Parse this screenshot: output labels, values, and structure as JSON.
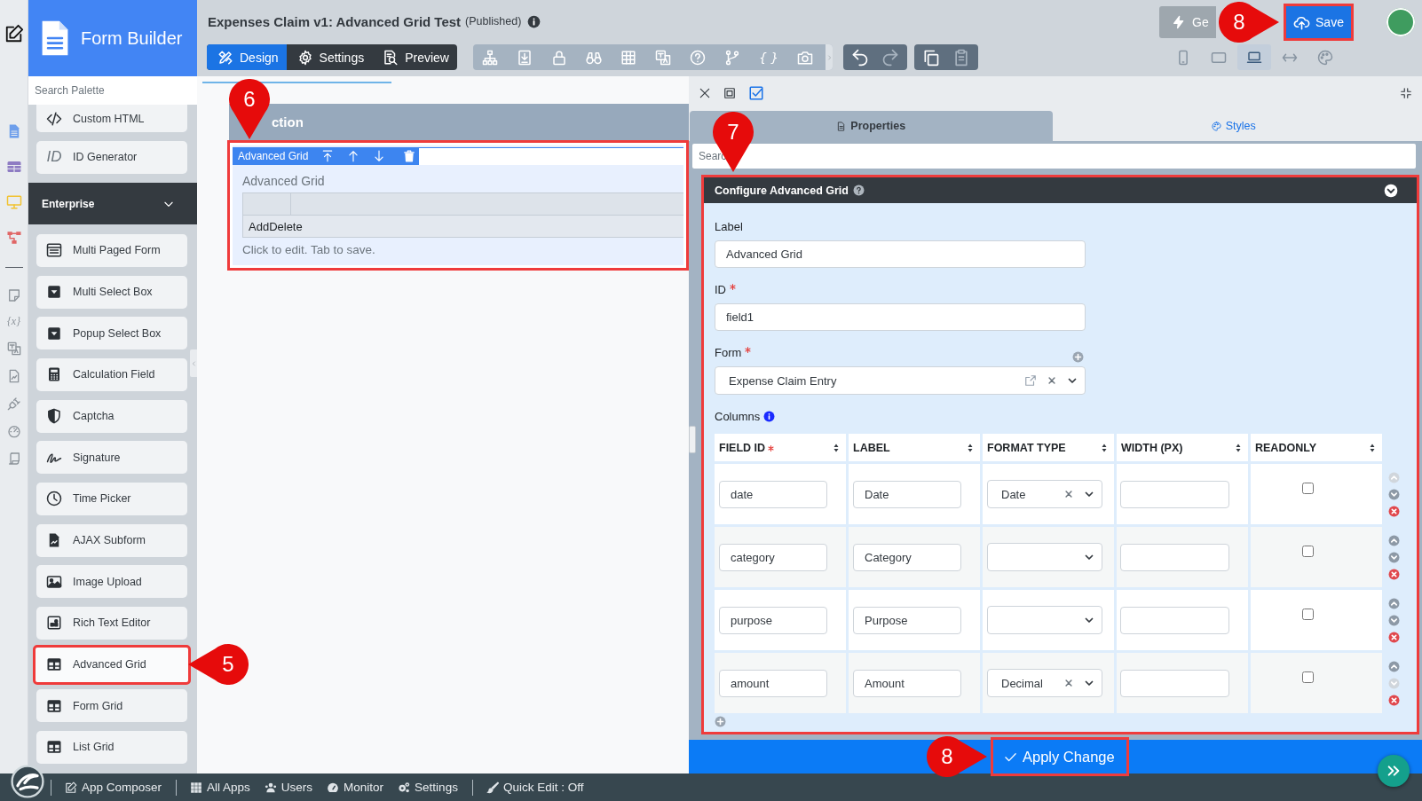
{
  "side_rail": {
    "glyph": "{x}"
  },
  "palette": {
    "title": "Form Builder",
    "search": {
      "placeholder": "Search Palette"
    },
    "items": [
      {
        "label": "Custom HTML",
        "highlighted": false
      },
      {
        "label": "ID Generator",
        "icon_text": "ID",
        "highlighted": false
      }
    ],
    "sections": [
      {
        "title": "Enterprise",
        "expanded": true,
        "items": [
          {
            "label": "Multi Paged Form",
            "highlighted": false
          },
          {
            "label": "Multi Select Box",
            "highlighted": false
          },
          {
            "label": "Popup Select Box",
            "highlighted": false
          },
          {
            "label": "Calculation Field",
            "highlighted": false
          },
          {
            "label": "Captcha",
            "highlighted": false
          },
          {
            "label": "Signature",
            "highlighted": false
          },
          {
            "label": "Time Picker",
            "highlighted": false
          },
          {
            "label": "AJAX Subform",
            "highlighted": false
          },
          {
            "label": "Image Upload",
            "highlighted": false
          },
          {
            "label": "Rich Text Editor",
            "highlighted": false
          },
          {
            "label": "Advanced Grid",
            "highlighted": true,
            "callout": "5"
          },
          {
            "label": "Form Grid",
            "highlighted": false
          },
          {
            "label": "List Grid",
            "highlighted": false
          }
        ]
      }
    ]
  },
  "header": {
    "title": "Expenses Claim v1: Advanced Grid Test",
    "status": "(Published)",
    "modes": [
      {
        "label": "Design",
        "selected": true
      },
      {
        "label": "Settings",
        "selected": false
      },
      {
        "label": "Preview",
        "selected": false
      }
    ],
    "toolbar": {
      "glyph": "{ }"
    },
    "history_actions": [
      {
        "disabled": false
      },
      {
        "disabled": true
      }
    ],
    "clipboard_actions": [
      {
        "disabled": false
      },
      {
        "disabled": true
      }
    ],
    "generate_button": {
      "label": "Ge"
    },
    "save_button": {
      "label": "Save",
      "highlighted": true,
      "callout": "8"
    },
    "view_modes": [
      {
        "selected": false
      },
      {
        "selected": false
      },
      {
        "selected": true
      },
      {
        "selected": false
      }
    ]
  },
  "canvas": {
    "section": {
      "title": "ction"
    },
    "element": {
      "tag": "Advanced Grid",
      "label": "Advanced Grid",
      "grid_row": "AddDelete",
      "hint": "Click to edit. Tab to save.",
      "highlighted": true,
      "callout": "6"
    }
  },
  "properties": {
    "tabs": [
      {
        "label": "Properties",
        "selected": true
      },
      {
        "label": "Styles",
        "selected": false
      }
    ],
    "search": {
      "placeholder": "Searc"
    },
    "panel": {
      "title": "Configure Advanced Grid",
      "expanded": true,
      "highlighted": true,
      "callout": "7",
      "fields": [
        {
          "kind": "text",
          "label": "Label",
          "required": false,
          "value": "Advanced Grid"
        },
        {
          "kind": "text",
          "label": "ID",
          "required": true,
          "value": "field1"
        },
        {
          "kind": "select",
          "label": "Form",
          "required": true,
          "value": "Expense Claim Entry"
        }
      ],
      "columns": {
        "label": "Columns",
        "headers": [
          {
            "label": "FIELD ID",
            "required": true
          },
          {
            "label": "LABEL",
            "required": false
          },
          {
            "label": "FORMAT TYPE",
            "required": false
          },
          {
            "label": "WIDTH (PX)",
            "required": false
          },
          {
            "label": "READONLY",
            "required": false
          }
        ],
        "rows": [
          {
            "field_id": "date",
            "label": "Date",
            "format_type": "Date",
            "readonly": false,
            "move_up_disabled": true,
            "move_down_disabled": false
          },
          {
            "field_id": "category",
            "label": "Category",
            "readonly": false,
            "move_up_disabled": false,
            "move_down_disabled": false
          },
          {
            "field_id": "purpose",
            "label": "Purpose",
            "readonly": false,
            "move_up_disabled": false,
            "move_down_disabled": false
          },
          {
            "field_id": "amount",
            "label": "Amount",
            "format_type": "Decimal",
            "readonly": false,
            "move_up_disabled": false,
            "move_down_disabled": true
          }
        ]
      }
    },
    "apply_button": {
      "label": "Apply Change",
      "highlighted": true,
      "callout": "8"
    }
  },
  "footer": {
    "groups": [
      {
        "items": [
          {
            "label": "App Composer"
          }
        ]
      },
      {
        "items": [
          {
            "label": "All Apps"
          },
          {
            "label": "Users"
          },
          {
            "label": "Monitor"
          },
          {
            "label": "Settings"
          }
        ]
      },
      {
        "items": [
          {
            "label": "Quick Edit : Off"
          }
        ]
      }
    ]
  }
}
